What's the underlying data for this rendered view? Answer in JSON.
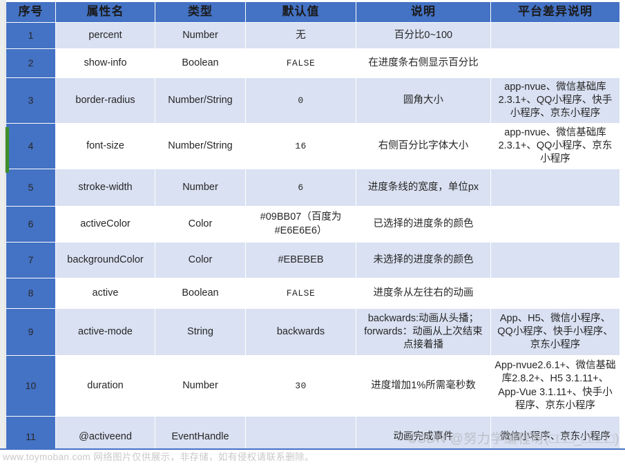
{
  "table": {
    "headers": [
      "序号",
      "属性名",
      "类型",
      "默认值",
      "说明",
      "平台差异说明"
    ],
    "rows": [
      {
        "index": "1",
        "name": "percent",
        "type": "Number",
        "default": "无",
        "desc": "百分比0~100",
        "platform": ""
      },
      {
        "index": "2",
        "name": "show-info",
        "type": "Boolean",
        "default": "FALSE",
        "desc": "在进度条右侧显示百分比",
        "platform": ""
      },
      {
        "index": "3",
        "name": "border-radius",
        "type": "Number/String",
        "default": "0",
        "desc": "圆角大小",
        "platform": "app-nvue、微信基础库2.3.1+、QQ小程序、快手小程序、京东小程序"
      },
      {
        "index": "4",
        "name": "font-size",
        "type": "Number/String",
        "default": "16",
        "desc": "右侧百分比字体大小",
        "platform": "app-nvue、微信基础库2.3.1+、QQ小程序、京东小程序"
      },
      {
        "index": "5",
        "name": "stroke-width",
        "type": "Number",
        "default": "6",
        "desc": "进度条线的宽度，单位px",
        "platform": ""
      },
      {
        "index": "6",
        "name": "activeColor",
        "type": "Color",
        "default": "#09BB07（百度为#E6E6E6）",
        "desc": "已选择的进度条的颜色",
        "platform": ""
      },
      {
        "index": "7",
        "name": "backgroundColor",
        "type": "Color",
        "default": "#EBEBEB",
        "desc": "未选择的进度条的颜色",
        "platform": ""
      },
      {
        "index": "8",
        "name": "active",
        "type": "Boolean",
        "default": "FALSE",
        "desc": "进度条从左往右的动画",
        "platform": ""
      },
      {
        "index": "9",
        "name": "active-mode",
        "type": "String",
        "default": "backwards",
        "desc": "backwards:动画从头播；forwards：动画从上次结束点接着播",
        "platform": "App、H5、微信小程序、QQ小程序、快手小程序、京东小程序"
      },
      {
        "index": "10",
        "name": "duration",
        "type": "Number",
        "default": "30",
        "desc": "进度增加1%所需毫秒数",
        "platform": "App-nvue2.6.1+、微信基础库2.8.2+、H5 3.1.11+、App-Vue 3.1.11+、快手小程序、京东小程序"
      },
      {
        "index": "11",
        "name": "@activeend",
        "type": "EventHandle",
        "default": "",
        "desc": "动画完成事件",
        "platform": "微信小程序、京东小程序"
      }
    ]
  },
  "watermarks": {
    "bottom": "www.toymoban.com 网络图片仅供展示，非存储，如有侵权请联系删除。",
    "csdn": "CSDN @努力学编程呀(□□□_□□□□)"
  },
  "colors": {
    "header_blue": "#4472C4",
    "row_shade": "#D9E1F2",
    "selection_green": "#3F8F29"
  }
}
